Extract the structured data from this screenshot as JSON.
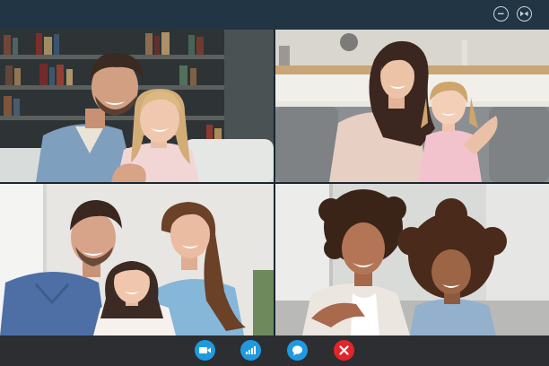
{
  "window": {
    "controls": [
      {
        "icon": "minimize-icon"
      },
      {
        "icon": "fullscreen-icon"
      }
    ]
  },
  "participants": [
    {
      "tile": "top-left",
      "description_hidden": true
    },
    {
      "tile": "top-right",
      "description_hidden": true
    },
    {
      "tile": "bottom-left",
      "description_hidden": true
    },
    {
      "tile": "bottom-right",
      "description_hidden": true
    }
  ],
  "toolbar": {
    "buttons": [
      {
        "icon": "video-camera-icon",
        "color": "#1e9be0"
      },
      {
        "icon": "signal-bars-icon",
        "color": "#1e9be0"
      },
      {
        "icon": "chat-bubble-icon",
        "color": "#1e9be0"
      },
      {
        "icon": "end-call-icon",
        "color": "#e0262b"
      }
    ]
  },
  "colors": {
    "titlebar": "#213544",
    "toolbar": "#2d2e31",
    "accent": "#1e9be0",
    "danger": "#e0262b"
  }
}
